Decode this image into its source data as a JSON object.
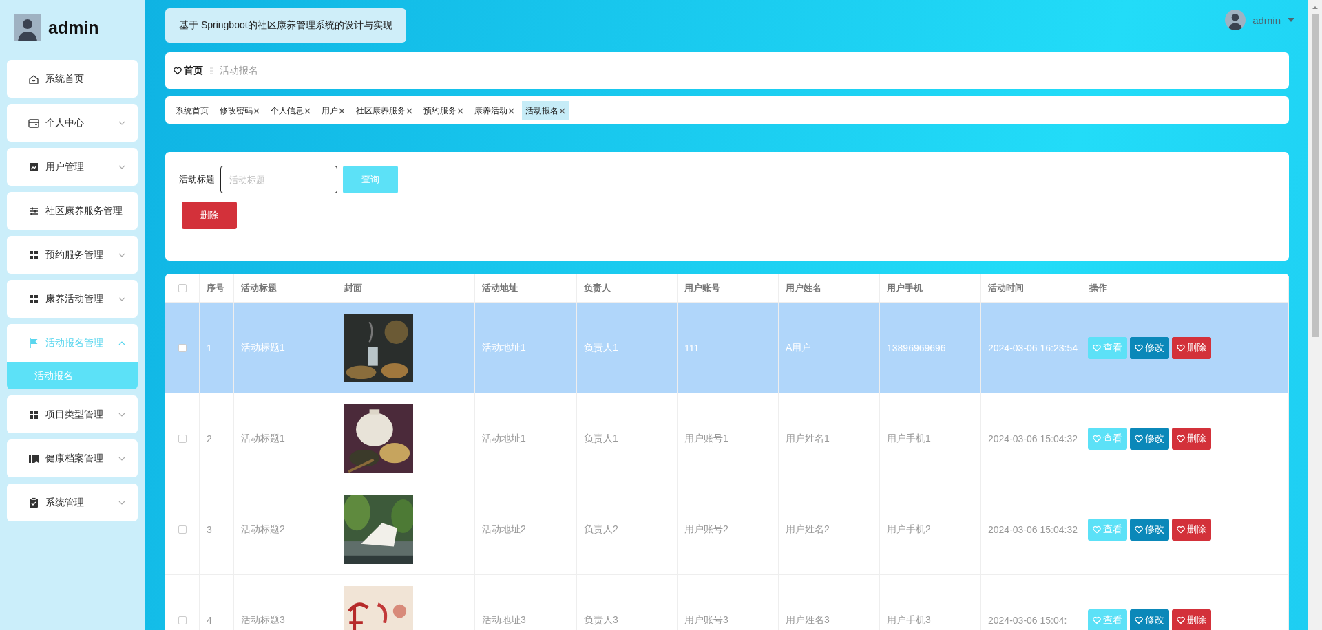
{
  "sidebar": {
    "user": "admin",
    "menu": [
      {
        "label": "系统首页",
        "selected": false
      },
      {
        "label": "个人中心",
        "selected": false,
        "expanded": false
      },
      {
        "label": "用户管理",
        "selected": false,
        "expanded": false
      },
      {
        "label": "社区康养服务管理",
        "selected": false
      },
      {
        "label": "预约服务管理",
        "selected": false,
        "expanded": false
      },
      {
        "label": "康养活动管理",
        "selected": false,
        "expanded": false
      },
      {
        "label": "活动报名管理",
        "selected": true,
        "expanded": true,
        "children": [
          {
            "label": "活动报名",
            "selected": true
          }
        ]
      },
      {
        "label": "项目类型管理",
        "selected": false,
        "expanded": false
      },
      {
        "label": "健康档案管理",
        "selected": false,
        "expanded": false
      },
      {
        "label": "系统管理",
        "selected": false,
        "expanded": false
      }
    ]
  },
  "header": {
    "title": "基于 Springboot的社区康养管理系统的设计与实现",
    "user": "admin"
  },
  "breadcrumb": [
    "首页",
    "活动报名"
  ],
  "tabs": [
    {
      "label": "系统首页",
      "closable": false,
      "selected": false
    },
    {
      "label": "修改密码",
      "closable": true,
      "selected": false
    },
    {
      "label": "个人信息",
      "closable": true,
      "selected": false
    },
    {
      "label": "用户",
      "closable": true,
      "selected": false
    },
    {
      "label": "社区康养服务",
      "closable": true,
      "selected": false
    },
    {
      "label": "预约服务",
      "closable": true,
      "selected": false
    },
    {
      "label": "康养活动",
      "closable": true,
      "selected": false
    },
    {
      "label": "活动报名",
      "closable": true,
      "selected": true
    }
  ],
  "search": {
    "label": "活动标题",
    "placeholder": "活动标题",
    "button": "查询"
  },
  "delete_button": "删除",
  "table": {
    "select_all": {
      "checked": false
    },
    "columns": [
      "序号",
      "活动标题",
      "封面",
      "活动地址",
      "负责人",
      "用户账号",
      "用户姓名",
      "用户手机",
      "活动时间",
      "操作"
    ],
    "rows": [
      {
        "checked": false,
        "selected": true,
        "cells": [
          "1",
          "活动标题1",
          {
            "kind": "picture"
          },
          "活动地址1",
          "负责人1",
          "111",
          "A用户",
          "13896969696",
          "2024-03-06 16:23:54"
        ],
        "actions": [
          {
            "label": "查看",
            "kind": "view"
          },
          {
            "label": "修改",
            "kind": "edit"
          },
          {
            "label": "删除",
            "kind": "delete"
          }
        ]
      },
      {
        "checked": false,
        "selected": false,
        "cells": [
          "2",
          "活动标题1",
          {
            "kind": "picture"
          },
          "活动地址1",
          "负责人1",
          "用户账号1",
          "用户姓名1",
          "用户手机1",
          "2024-03-06 15:04:32"
        ],
        "actions": [
          {
            "label": "查看",
            "kind": "view"
          },
          {
            "label": "修改",
            "kind": "edit"
          },
          {
            "label": "删除",
            "kind": "delete"
          }
        ]
      },
      {
        "checked": false,
        "selected": false,
        "cells": [
          "3",
          "活动标题2",
          {
            "kind": "picture"
          },
          "活动地址2",
          "负责人2",
          "用户账号2",
          "用户姓名2",
          "用户手机2",
          "2024-03-06 15:04:32"
        ],
        "actions": [
          {
            "label": "查看",
            "kind": "view"
          },
          {
            "label": "修改",
            "kind": "edit"
          },
          {
            "label": "删除",
            "kind": "delete"
          }
        ]
      },
      {
        "checked": false,
        "selected": false,
        "cells": [
          "4",
          "活动标题3",
          {
            "kind": "picture"
          },
          "活动地址3",
          "负责人3",
          "用户账号3",
          "用户姓名3",
          "用户手机3",
          "2024-03-06 15:04:"
        ],
        "actions": [
          {
            "label": "查看",
            "kind": "view"
          },
          {
            "label": "修改",
            "kind": "edit"
          },
          {
            "label": "删除",
            "kind": "delete"
          }
        ]
      }
    ]
  }
}
